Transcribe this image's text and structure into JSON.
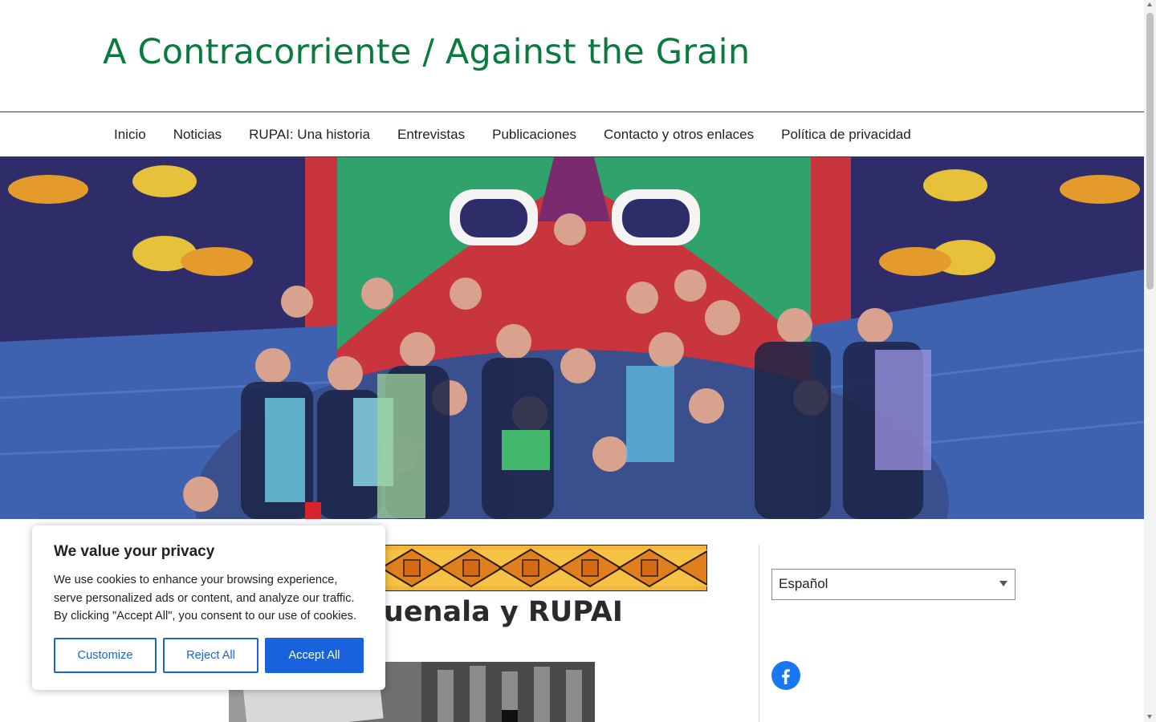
{
  "header": {
    "site_title": "A Contracorriente / Against the Grain"
  },
  "nav": {
    "items": [
      "Inicio",
      "Noticias",
      "RUPAI: Una historia",
      "Entrevistas",
      "Publicaciones",
      "Contacto y otros enlaces",
      "Política de privacidad"
    ]
  },
  "main": {
    "post_title": "Alberto Muenala y RUPAI"
  },
  "sidebar": {
    "language_selected": "Español",
    "social_icon": "facebook-icon"
  },
  "cookie_banner": {
    "title": "We value your privacy",
    "text": "We use cookies to enhance your browsing experience, serve personalized ads or content, and analyze our traffic. By clicking \"Accept All\", you consent to our use of cookies.",
    "customize_label": "Customize",
    "reject_label": "Reject All",
    "accept_label": "Accept All"
  },
  "colors": {
    "title_green": "#0b7a3f",
    "accent_blue": "#1863dc",
    "facebook_blue": "#1877f2"
  }
}
